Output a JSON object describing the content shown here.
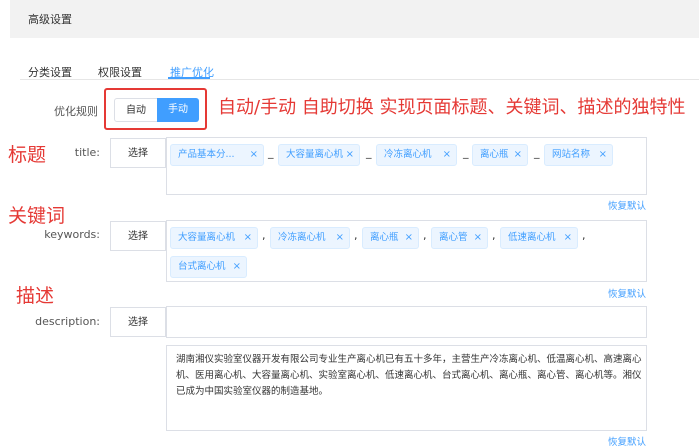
{
  "header": {
    "title": "高级设置"
  },
  "tabs": [
    {
      "label": "分类设置"
    },
    {
      "label": "权限设置"
    },
    {
      "label": "推广优化"
    }
  ],
  "rule": {
    "label": "优化规则",
    "auto_label": "自动",
    "manual_label": "手动",
    "selected": "手动"
  },
  "annotations": {
    "main": "自动/手动 自助切换 实现页面标题、关键词、描述的独特性",
    "title": "标题",
    "keywords": "关键词",
    "description": "描述"
  },
  "title_field": {
    "label": "title:",
    "select_label": "选择",
    "separator": "_",
    "tags": [
      "产品基本分...",
      "大容量离心机",
      "冷冻离心机",
      "离心瓶",
      "网站名称"
    ],
    "restore_label": "恢复默认"
  },
  "keywords_field": {
    "label": "keywords:",
    "select_label": "选择",
    "separator": ",",
    "tags": [
      "大容量离心机",
      "冷冻离心机",
      "离心瓶",
      "离心管",
      "低速离心机",
      "台式离心机"
    ],
    "restore_label": "恢复默认"
  },
  "description_field": {
    "label": "description:",
    "select_label": "选择",
    "text": "湖南湘仪实验室仪器开发有限公司专业生产离心机已有五十多年，主营生产冷冻离心机、低温离心机、高速离心机、医用离心机、大容量离心机、实验室离心机、低速离心机、台式离心机、离心瓶、离心管、离心机等。湘仪已成为中国实验室仪器的制造基地。",
    "restore_label": "恢复默认"
  },
  "colors": {
    "accent": "#409eff",
    "annotation": "#e53935"
  }
}
